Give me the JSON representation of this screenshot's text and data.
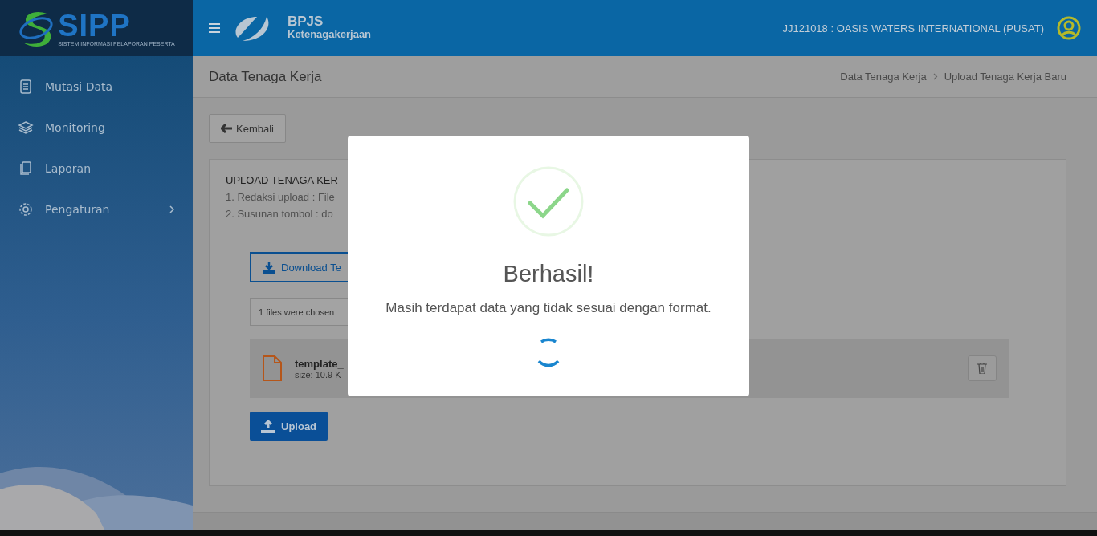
{
  "sidebar": {
    "logo": {
      "title": "SIPP",
      "subtitle": "SISTEM INFORMASI PELAPORAN PESERTA"
    },
    "items": [
      {
        "label": "Mutasi Data",
        "expandable": false
      },
      {
        "label": "Monitoring",
        "expandable": false
      },
      {
        "label": "Laporan",
        "expandable": false
      },
      {
        "label": "Pengaturan",
        "expandable": true
      }
    ]
  },
  "header": {
    "brand": {
      "name": "BPJS",
      "sub": "Ketenagakerjaan"
    },
    "account": "JJ121018 : OASIS WATERS INTERNATIONAL (PUSAT)"
  },
  "page": {
    "title": "Data Tenaga Kerja",
    "breadcrumb": [
      "Data Tenaga Kerja",
      "Upload Tenaga Kerja Baru"
    ],
    "back_button": "Kembali",
    "card": {
      "title": "UPLOAD TENAGA KER",
      "notes": [
        "1. Redaksi upload : File",
        "2. Susunan tombol : do"
      ],
      "download_button": "Download Te",
      "file_field": "1 files were chosen",
      "file": {
        "name": "template_",
        "size": "size: 10.9 K"
      },
      "upload_button": "Upload"
    }
  },
  "dialog": {
    "title": "Berhasil!",
    "message": "Masih terdapat data yang tidak sesuai dengan format.",
    "loading": true
  }
}
